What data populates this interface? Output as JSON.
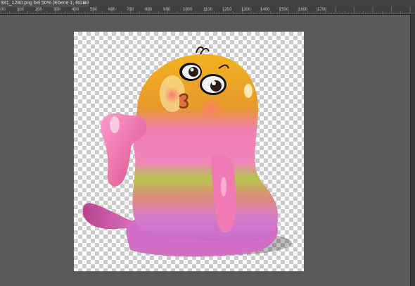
{
  "document_tab": {
    "title": "981_1280.png bei 50% (Ebene 1, RGB/8)",
    "close_glyph": "×"
  },
  "ruler": {
    "labels": [
      "00",
      "100",
      "200",
      "300",
      "400",
      "500",
      "600",
      "700",
      "800",
      "900",
      "1000",
      "1100",
      "1200",
      "1300",
      "1400",
      "1500",
      "1600",
      "1700"
    ]
  },
  "canvas": {
    "background": "transparency-checkerboard",
    "image_subject": "glossy-gummy-creature"
  },
  "colors": {
    "workspace": "#595959",
    "ruler": "#404040",
    "tab_bar": "#424242",
    "checker_light": "#ffffff",
    "checker_dark": "#cccccc"
  }
}
